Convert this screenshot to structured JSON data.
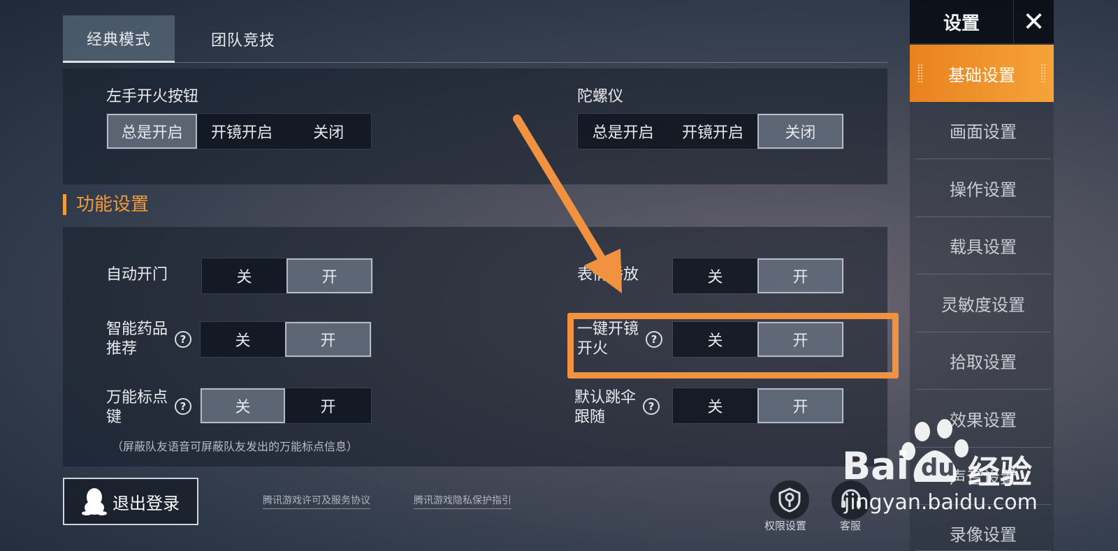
{
  "tabs": [
    {
      "label": "经典模式",
      "active": true
    },
    {
      "label": "团队竞技",
      "active": false
    }
  ],
  "top_panel": {
    "left_fire": {
      "label": "左手开火按钮",
      "options": [
        "总是开启",
        "开镜开启",
        "关闭"
      ],
      "selected": "总是开启"
    },
    "gyroscope": {
      "label": "陀螺仪",
      "options": [
        "总是开启",
        "开镜开启",
        "关闭"
      ],
      "selected": "关闭"
    }
  },
  "section_title": "功能设置",
  "functions": {
    "auto_door": {
      "label": "自动开门",
      "off": "关",
      "on": "开",
      "selected": "开"
    },
    "emote_play": {
      "label": "表情播放",
      "off": "关",
      "on": "开",
      "selected": "开"
    },
    "smart_med_line1": "智能药品",
    "smart_med_line2": "推荐",
    "smart_med": {
      "off": "关",
      "on": "开",
      "selected": "开"
    },
    "one_key_line1": "一键开镜",
    "one_key_line2": "开火",
    "one_key": {
      "off": "关",
      "on": "开",
      "selected": "开"
    },
    "universal_mark_line1": "万能标点",
    "universal_mark_line2": "键",
    "universal_mark": {
      "off": "关",
      "on": "开",
      "selected": "关"
    },
    "follow_para_line1": "默认跳伞",
    "follow_para_line2": "跟随",
    "follow_para": {
      "off": "关",
      "on": "开",
      "selected": "开"
    },
    "help_glyph": "?",
    "note": "（屏蔽队友语音可屏蔽队友发出的万能标点信息）"
  },
  "sidebar": {
    "title": "设置",
    "close_glyph": "✕",
    "items": [
      {
        "label": "基础设置",
        "active": true
      },
      {
        "label": "画面设置"
      },
      {
        "label": "操作设置"
      },
      {
        "label": "载具设置"
      },
      {
        "label": "灵敏度设置"
      },
      {
        "label": "拾取设置"
      },
      {
        "label": "效果设置"
      },
      {
        "label": "声音设置"
      },
      {
        "label": "录像设置"
      }
    ]
  },
  "bottom": {
    "logout": "退出登录",
    "link_license": "腾讯游戏许可及服务协议",
    "link_privacy": "腾讯游戏隐私保护指引",
    "permissions": "权限设置",
    "support": "客服"
  },
  "watermark": {
    "brand": "Bai",
    "brand2": "du",
    "brand_cn": "经验",
    "url": "jingyan.baidu.com"
  },
  "colors": {
    "accent": "#f39a3b",
    "annotation": "#f0923f",
    "sidebar_active": "#f09030"
  }
}
